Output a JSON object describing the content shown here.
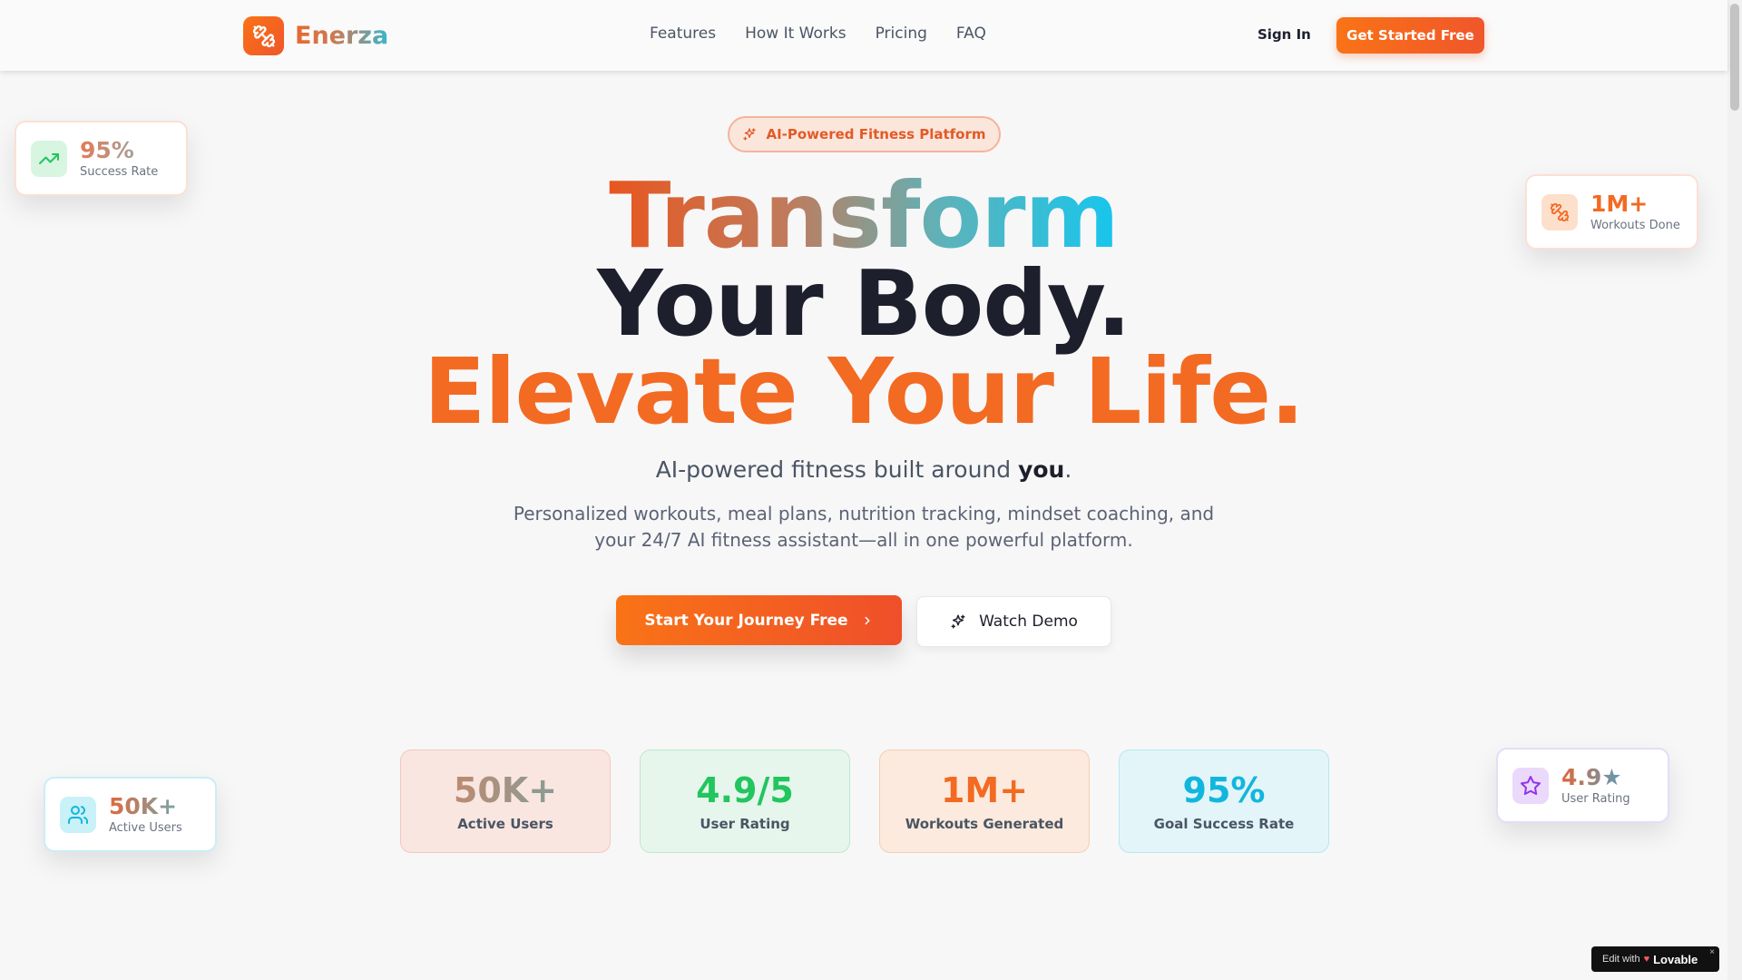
{
  "nav": {
    "brand": "Enerza",
    "links": [
      "Features",
      "How It Works",
      "Pricing",
      "FAQ"
    ],
    "sign_in": "Sign In",
    "get_started": "Get Started Free"
  },
  "hero": {
    "badge": "AI-Powered Fitness Platform",
    "line1": "Transform",
    "line2": "Your Body.",
    "line3": "Elevate Your Life.",
    "tagline_prefix": "AI-powered fitness built around ",
    "tagline_bold": "you",
    "tagline_suffix": ".",
    "description": "Personalized workouts, meal plans, nutrition tracking, mindset coaching, and your 24/7 AI fitness assistant—all in one powerful platform.",
    "primary_cta": "Start Your Journey Free",
    "secondary_cta": "Watch Demo"
  },
  "stats": [
    {
      "value": "50K+",
      "label": "Active Users"
    },
    {
      "value": "4.9/5",
      "label": "User Rating"
    },
    {
      "value": "1M+",
      "label": "Workouts Generated"
    },
    {
      "value": "95%",
      "label": "Goal Success Rate"
    }
  ],
  "floating": {
    "success": {
      "value": "95%",
      "label": "Success Rate",
      "icon": "trending-up-icon"
    },
    "workouts": {
      "value": "1M+",
      "label": "Workouts Done",
      "icon": "dumbbell-icon"
    },
    "users": {
      "value": "50K+",
      "label": "Active Users",
      "icon": "users-icon"
    },
    "rating": {
      "value": "4.9★",
      "label": "User Rating",
      "icon": "star-icon"
    }
  },
  "badge_lovable": {
    "prefix": "Edit with",
    "brand": "Lovable",
    "close": "×"
  },
  "colors": {
    "accent": "#f97316",
    "accent_dark": "#ef4f2a",
    "cyan": "#16c6ee",
    "green": "#22c55e"
  }
}
